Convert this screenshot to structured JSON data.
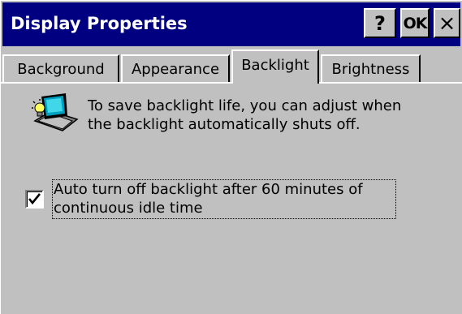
{
  "window": {
    "title": "Display Properties",
    "help_button": "?",
    "ok_button": "OK",
    "close_button": "×"
  },
  "tabs": [
    {
      "label": "Background",
      "active": false
    },
    {
      "label": "Appearance",
      "active": false
    },
    {
      "label": "Backlight",
      "active": true
    },
    {
      "label": "Brightness",
      "active": false
    }
  ],
  "backlight": {
    "icon": "laptop-backlight-icon",
    "info_line_1": "To save backlight life, you can adjust when",
    "info_line_2": "the backlight automatically shuts off.",
    "auto_off_checked": true,
    "auto_off_line_1": "Auto turn off backlight after 60 minutes of",
    "auto_off_line_2": "continuous idle time"
  },
  "colors": {
    "title_bar": "#000080",
    "face": "#c0c0c0"
  }
}
